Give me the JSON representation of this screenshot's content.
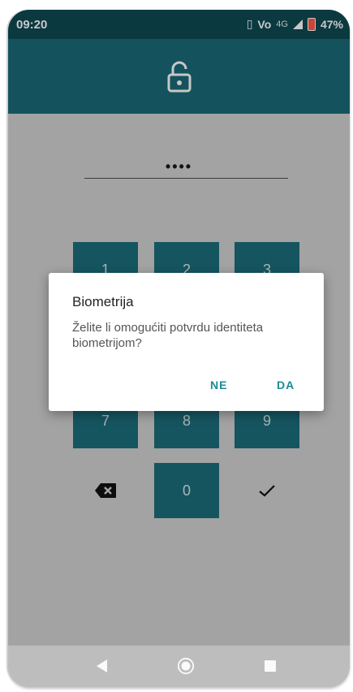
{
  "status_bar": {
    "time": "09:20",
    "volte": "Vo",
    "network": "4G",
    "battery": "47%"
  },
  "header": {
    "icon": "unlocked-padlock-icon",
    "color": "#1a6b78"
  },
  "pin": {
    "masked_value": "••••"
  },
  "keypad": {
    "keys": [
      "1",
      "2",
      "3",
      "7",
      "8",
      "9",
      "0"
    ],
    "delete_icon": "backspace-icon",
    "confirm_icon": "checkmark-icon",
    "key_color": "#1c6e7b"
  },
  "dialog": {
    "title": "Biometrija",
    "message": "Želite li omogućiti potvrdu identiteta biometrijom?",
    "negative_label": "NE",
    "positive_label": "DA",
    "accent": "#1b8b98"
  },
  "nav_bar": {
    "back_icon": "back-triangle-icon",
    "home_icon": "home-circle-icon",
    "recents_icon": "recents-square-icon"
  }
}
